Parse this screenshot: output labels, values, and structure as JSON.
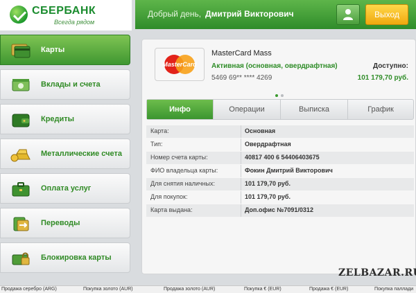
{
  "logo": {
    "name": "СБЕРБАНК",
    "tagline": "Всегда рядом"
  },
  "header": {
    "greeting": "Добрый день,",
    "user_name": "Дмитрий Викторович",
    "exit_label": "Выход"
  },
  "sidebar": {
    "items": [
      {
        "label": "Карты",
        "icon": "cards-icon",
        "active": true
      },
      {
        "label": "Вклады и счета",
        "icon": "deposits-icon",
        "active": false
      },
      {
        "label": "Кредиты",
        "icon": "wallet-icon",
        "active": false
      },
      {
        "label": "Металлические счета",
        "icon": "gold-bars-icon",
        "active": false
      },
      {
        "label": "Оплата услуг",
        "icon": "briefcase-icon",
        "active": false
      },
      {
        "label": "Переводы",
        "icon": "transfer-icon",
        "active": false
      },
      {
        "label": "Блокировка карты",
        "icon": "lock-card-icon",
        "active": false
      }
    ]
  },
  "card": {
    "brand_text": "MasterCard",
    "name": "MasterCard Mass",
    "status": "Активная (основная, овердрафтная)",
    "number": "5469 69** **** 4269",
    "available_label": "Доступно:",
    "available_value": "101 179,70 руб."
  },
  "tabs": [
    {
      "label": "Инфо",
      "active": true
    },
    {
      "label": "Операции",
      "active": false
    },
    {
      "label": "Выписка",
      "active": false
    },
    {
      "label": "График",
      "active": false
    }
  ],
  "info": [
    {
      "key": "Карта:",
      "value": "Основная"
    },
    {
      "key": "Тип:",
      "value": "Овердрафтная"
    },
    {
      "key": "Номер счета карты:",
      "value": "40817 400 6 54406403675"
    },
    {
      "key": "ФИО владельца карты:",
      "value": "Фокин Дмитрий Викторович"
    },
    {
      "key": "Для снятия наличных:",
      "value": "101 179,70 руб."
    },
    {
      "key": "Для покупок:",
      "value": "101 179,70 руб."
    },
    {
      "key": "Карта выдана:",
      "value": "Доп.офис №7091/0312"
    }
  ],
  "ticker": [
    "Продажа серебро (ARG)",
    "Покупка золото (AUR)",
    "Продажа золото (AUR)",
    "Покупка € (EUR)",
    "Продажа € (EUR)",
    "Покупка паллади"
  ],
  "watermark": "ZELBAZAR.RU",
  "colors": {
    "brand_green": "#2f8c2a",
    "accent_yellow": "#f0a90f",
    "text_green": "#2e8c27"
  }
}
